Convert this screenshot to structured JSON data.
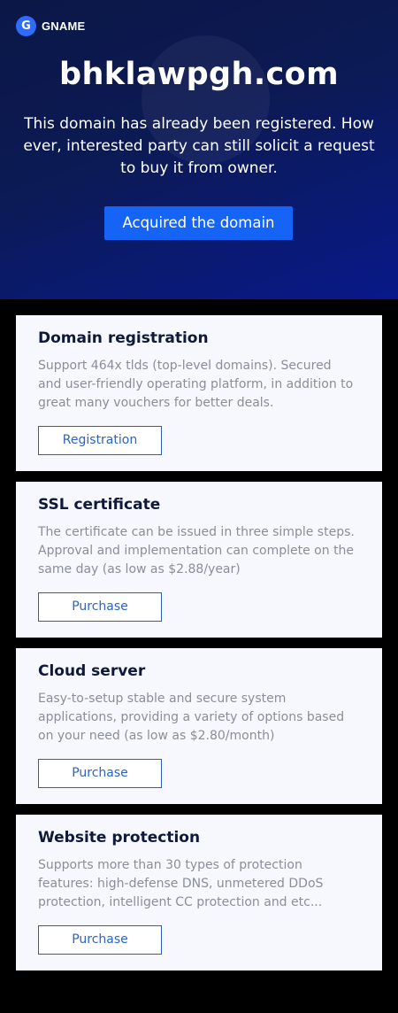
{
  "brand": {
    "logo_glyph": "G",
    "name": "GNAME",
    "logo_color": "#2f6bff"
  },
  "hero": {
    "domain": "bhklawpgh.com",
    "message": "This domain has already been registered. However, interested party can still solicit a request to buy it from owner.",
    "message_lines": [
      "This domain has already been registered. How",
      "ever, interested party can still solicit a request",
      "to buy it from owner."
    ],
    "button_label": "Acquired the domain",
    "button_color": "#1664f6"
  },
  "services": [
    {
      "title": "Domain registration",
      "description": "Support 464x tlds (top-level domains). Secured and user-friendly operating platform, in addition to great many vouchers for better deals.",
      "desc_lines": [
        "Support 464x tlds (top-level domains). Secured",
        "and user-friendly operating platform, in addition to",
        "great many vouchers for better deals."
      ],
      "button_label": "Registration"
    },
    {
      "title": "SSL certificate",
      "description": "The certificate can be issued in three simple steps. Approval and implementation can complete on the same day (as low as $2.88/year)",
      "desc_lines": [
        "The certificate can be issued in three simple steps.",
        "Approval and implementation can complete on the",
        "same day (as low as $2.88/year)"
      ],
      "button_label": "Purchase"
    },
    {
      "title": "Cloud server",
      "description": "Easy-to-setup stable and secure system applications, providing a variety of options based on your need (as low as $2.80/month)",
      "desc_lines": [
        "Easy-to-setup stable and secure system",
        "applications, providing a variety of options based",
        "on your need (as low as $2.80/month)"
      ],
      "button_label": "Purchase"
    },
    {
      "title": "Website protection",
      "description": "Supports more than 30 types of protection features: high-defense DNS, unmetered DDoS protection, intelligent CC protection and etc...",
      "desc_lines": [
        "Supports more than 30 types of protection",
        "features: high-defense DNS, unmetered DDoS",
        "protection, intelligent CC protection and etc..."
      ],
      "button_label": "Purchase"
    }
  ],
  "colors": {
    "hero_bg": "#0c1a55",
    "card_bg": "#f6f8fd",
    "card_title": "#0f1a3a",
    "card_desc": "#8a8e99",
    "outline_button": "#2b5fb4",
    "page_bg": "#000000"
  }
}
